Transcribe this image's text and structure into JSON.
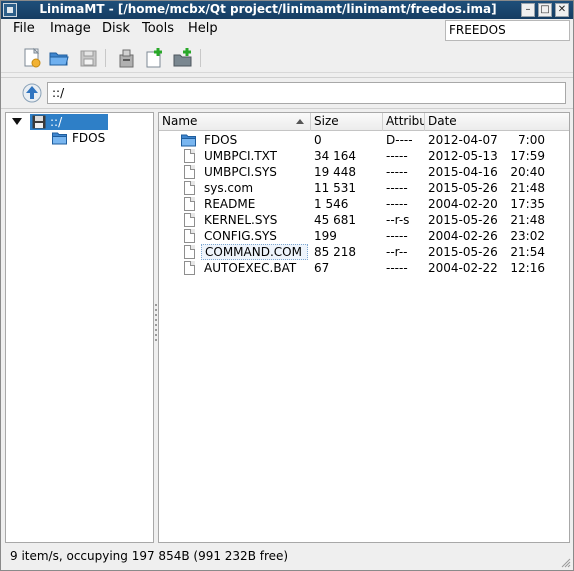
{
  "window": {
    "title": "LinimaMT - [/home/mcbx/Qt project/linimamt/linimamt/freedos.ima]",
    "minimize_glyph": "–",
    "maximize_glyph": "□",
    "close_glyph": "✕"
  },
  "menubar": {
    "items": [
      {
        "label": "File"
      },
      {
        "label": "Image"
      },
      {
        "label": "Disk"
      },
      {
        "label": "Tools"
      },
      {
        "label": "Help"
      }
    ],
    "volume_label": "FREEDOS"
  },
  "toolbar": {
    "buttons": [
      {
        "icon": "new-image-icon"
      },
      {
        "icon": "open-folder-icon"
      },
      {
        "icon": "save-disk-icon"
      },
      {
        "icon": "extract-archive-icon"
      },
      {
        "icon": "new-file-icon"
      },
      {
        "icon": "add-folder-icon"
      }
    ]
  },
  "addressbar": {
    "path": "::/"
  },
  "tree": {
    "root": {
      "label": "::/",
      "expanded": true
    },
    "children": [
      {
        "label": "FDOS"
      }
    ]
  },
  "filelist": {
    "columns": [
      "Name",
      "Size",
      "Attribu",
      "Date"
    ],
    "sorted_by": "Name",
    "rows": [
      {
        "type": "folder",
        "name": "FDOS",
        "size": "0",
        "attr": "D----",
        "date": "2012-04-07",
        "time": "7:00"
      },
      {
        "type": "file",
        "name": "UMBPCI.TXT",
        "size": "34 164",
        "attr": "-----",
        "date": "2012-05-13",
        "time": "17:59"
      },
      {
        "type": "file",
        "name": "UMBPCI.SYS",
        "size": "19 448",
        "attr": "-----",
        "date": "2015-04-16",
        "time": "20:40"
      },
      {
        "type": "file",
        "name": "sys.com",
        "size": "11 531",
        "attr": "-----",
        "date": "2015-05-26",
        "time": "21:48"
      },
      {
        "type": "file",
        "name": "README",
        "size": "1 546",
        "attr": "-----",
        "date": "2004-02-20",
        "time": "17:35"
      },
      {
        "type": "file",
        "name": "KERNEL.SYS",
        "size": "45 681",
        "attr": "--r-s",
        "date": "2015-05-26",
        "time": "21:48"
      },
      {
        "type": "file",
        "name": "CONFIG.SYS",
        "size": "199",
        "attr": "-----",
        "date": "2004-02-26",
        "time": "23:02"
      },
      {
        "type": "file",
        "name": "COMMAND.COM",
        "size": "85 218",
        "attr": "--r--",
        "date": "2015-05-26",
        "time": "21:54",
        "focused": true
      },
      {
        "type": "file",
        "name": "AUTOEXEC.BAT",
        "size": "67",
        "attr": "-----",
        "date": "2004-02-22",
        "time": "12:16"
      }
    ]
  },
  "statusbar": {
    "text": "9 item/s, occupying 197 854B (991 232B free)"
  },
  "colors": {
    "titlebar": "#1e4f7a",
    "selection": "#2e7fc7",
    "folder": "#4a90d9"
  }
}
